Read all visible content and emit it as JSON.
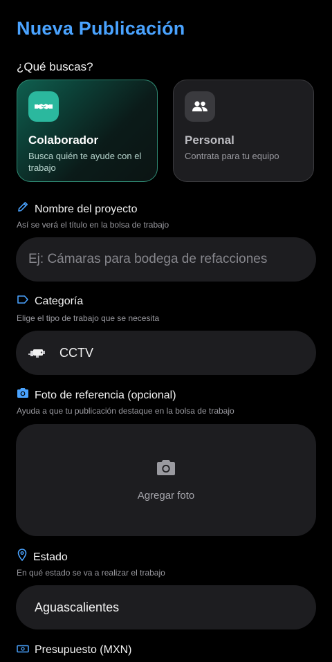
{
  "header": {
    "title": "Nueva Publicación"
  },
  "search_type": {
    "question": "¿Qué buscas?",
    "options": [
      {
        "title": "Colaborador",
        "description": "Busca quién te ayude con el trabajo",
        "icon": "handshake-icon",
        "selected": true
      },
      {
        "title": "Personal",
        "description": "Contrata para tu equipo",
        "icon": "group-icon",
        "selected": false
      }
    ]
  },
  "project_name": {
    "label": "Nombre del proyecto",
    "help": "Así se verá el título en la bolsa de trabajo",
    "placeholder": "Ej: Cámaras para bodega de refacciones",
    "icon": "pencil-icon"
  },
  "category": {
    "label": "Categoría",
    "help": "Elige el tipo de trabajo que se necesita",
    "value": "CCTV",
    "icon": "tag-icon",
    "value_icon": "cctv-camera-icon"
  },
  "photo": {
    "label": "Foto de referencia (opcional)",
    "help": "Ayuda a que tu publicación destaque en la bolsa de trabajo",
    "add_label": "Agregar foto",
    "icon": "camera-icon"
  },
  "state": {
    "label": "Estado",
    "help": "En qué estado se va a realizar el trabajo",
    "value": "Aguascalientes",
    "icon": "location-pin-icon"
  },
  "budget": {
    "label": "Presupuesto (MXN)",
    "icon": "banknote-icon"
  },
  "colors": {
    "accent_blue": "#4aa3ff",
    "teal": "#2bb89e",
    "surface": "#1d1d20",
    "background": "#000000"
  }
}
